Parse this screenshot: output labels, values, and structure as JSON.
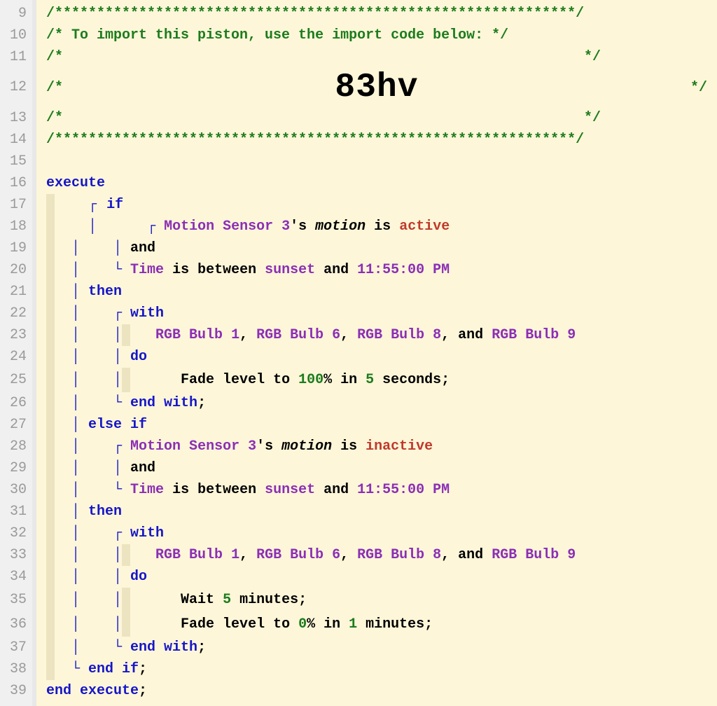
{
  "gutter": {
    "start": 9,
    "end": 39
  },
  "header": {
    "border": "/**************************************************************/",
    "l1": "/* To import this piston, use the import code below:         */",
    "side_l": "/*",
    "side_r": "*/",
    "code": "83hv"
  },
  "kw": {
    "execute": "execute",
    "if": "if",
    "and": "and",
    "then": "then",
    "with": "with",
    "do": "do",
    "endwith": "end with",
    "elseif": "else if",
    "endif": "end if",
    "endexecute": "end execute"
  },
  "cond": {
    "dev": "Motion Sensor 3",
    "poss": "'s ",
    "attr": "motion",
    "is": " is ",
    "active": "active",
    "inactive": "inactive",
    "time": "Time",
    "is_between": " is between ",
    "sunset": "sunset",
    "and_word": " and ",
    "clock": "11:55:00 PM"
  },
  "bulbs": {
    "b1": "RGB Bulb 1",
    "b6": "RGB Bulb 6",
    "b8": "RGB Bulb 8",
    "b9": "RGB Bulb 9",
    "sep": ", ",
    "and": ", and "
  },
  "act": {
    "fade_pre": "Fade level to ",
    "pct": "%",
    "in": " in ",
    "seconds": " seconds",
    "minutes": " minutes",
    "wait": "Wait ",
    "v100": "100",
    "v5": "5",
    "v0": "0",
    "v1": "1"
  },
  "punct": {
    "semi": ";"
  }
}
